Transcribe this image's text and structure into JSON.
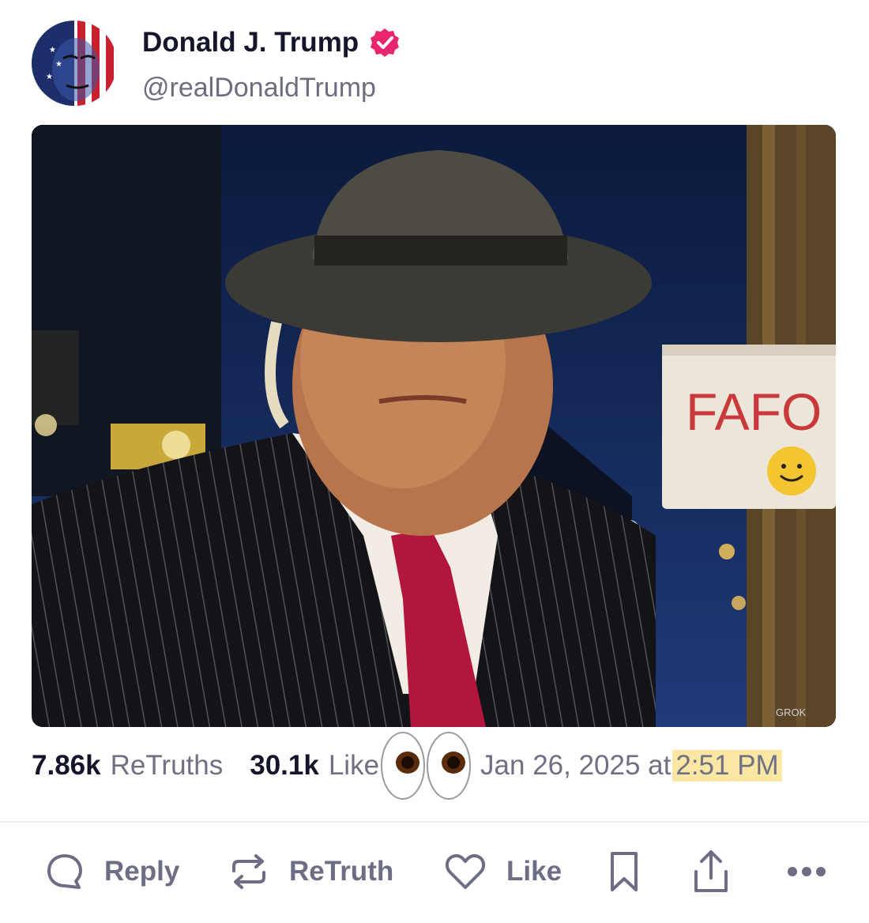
{
  "author": {
    "name": "Donald J. Trump",
    "handle": "@realDonaldTrump",
    "verified": true,
    "avatar_icon": "flag-painted-face-avatar"
  },
  "post": {
    "image_icon": "man-in-fedora-and-pinstripe-suit-photo",
    "sign_text": "FAFO",
    "watermark": "GROK"
  },
  "stats": {
    "retruths_count": "7.86k",
    "retruths_label": "ReTruths",
    "likes_count": "30.1k",
    "likes_label": "Like",
    "date": "Jan 26, 2025 at",
    "time": "2:51 PM"
  },
  "actions": {
    "reply": "Reply",
    "retruth": "ReTruth",
    "like": "Like"
  },
  "colors": {
    "accent": "#e8256e",
    "muted": "#6d6d85",
    "highlight": "#fbe7a4"
  }
}
